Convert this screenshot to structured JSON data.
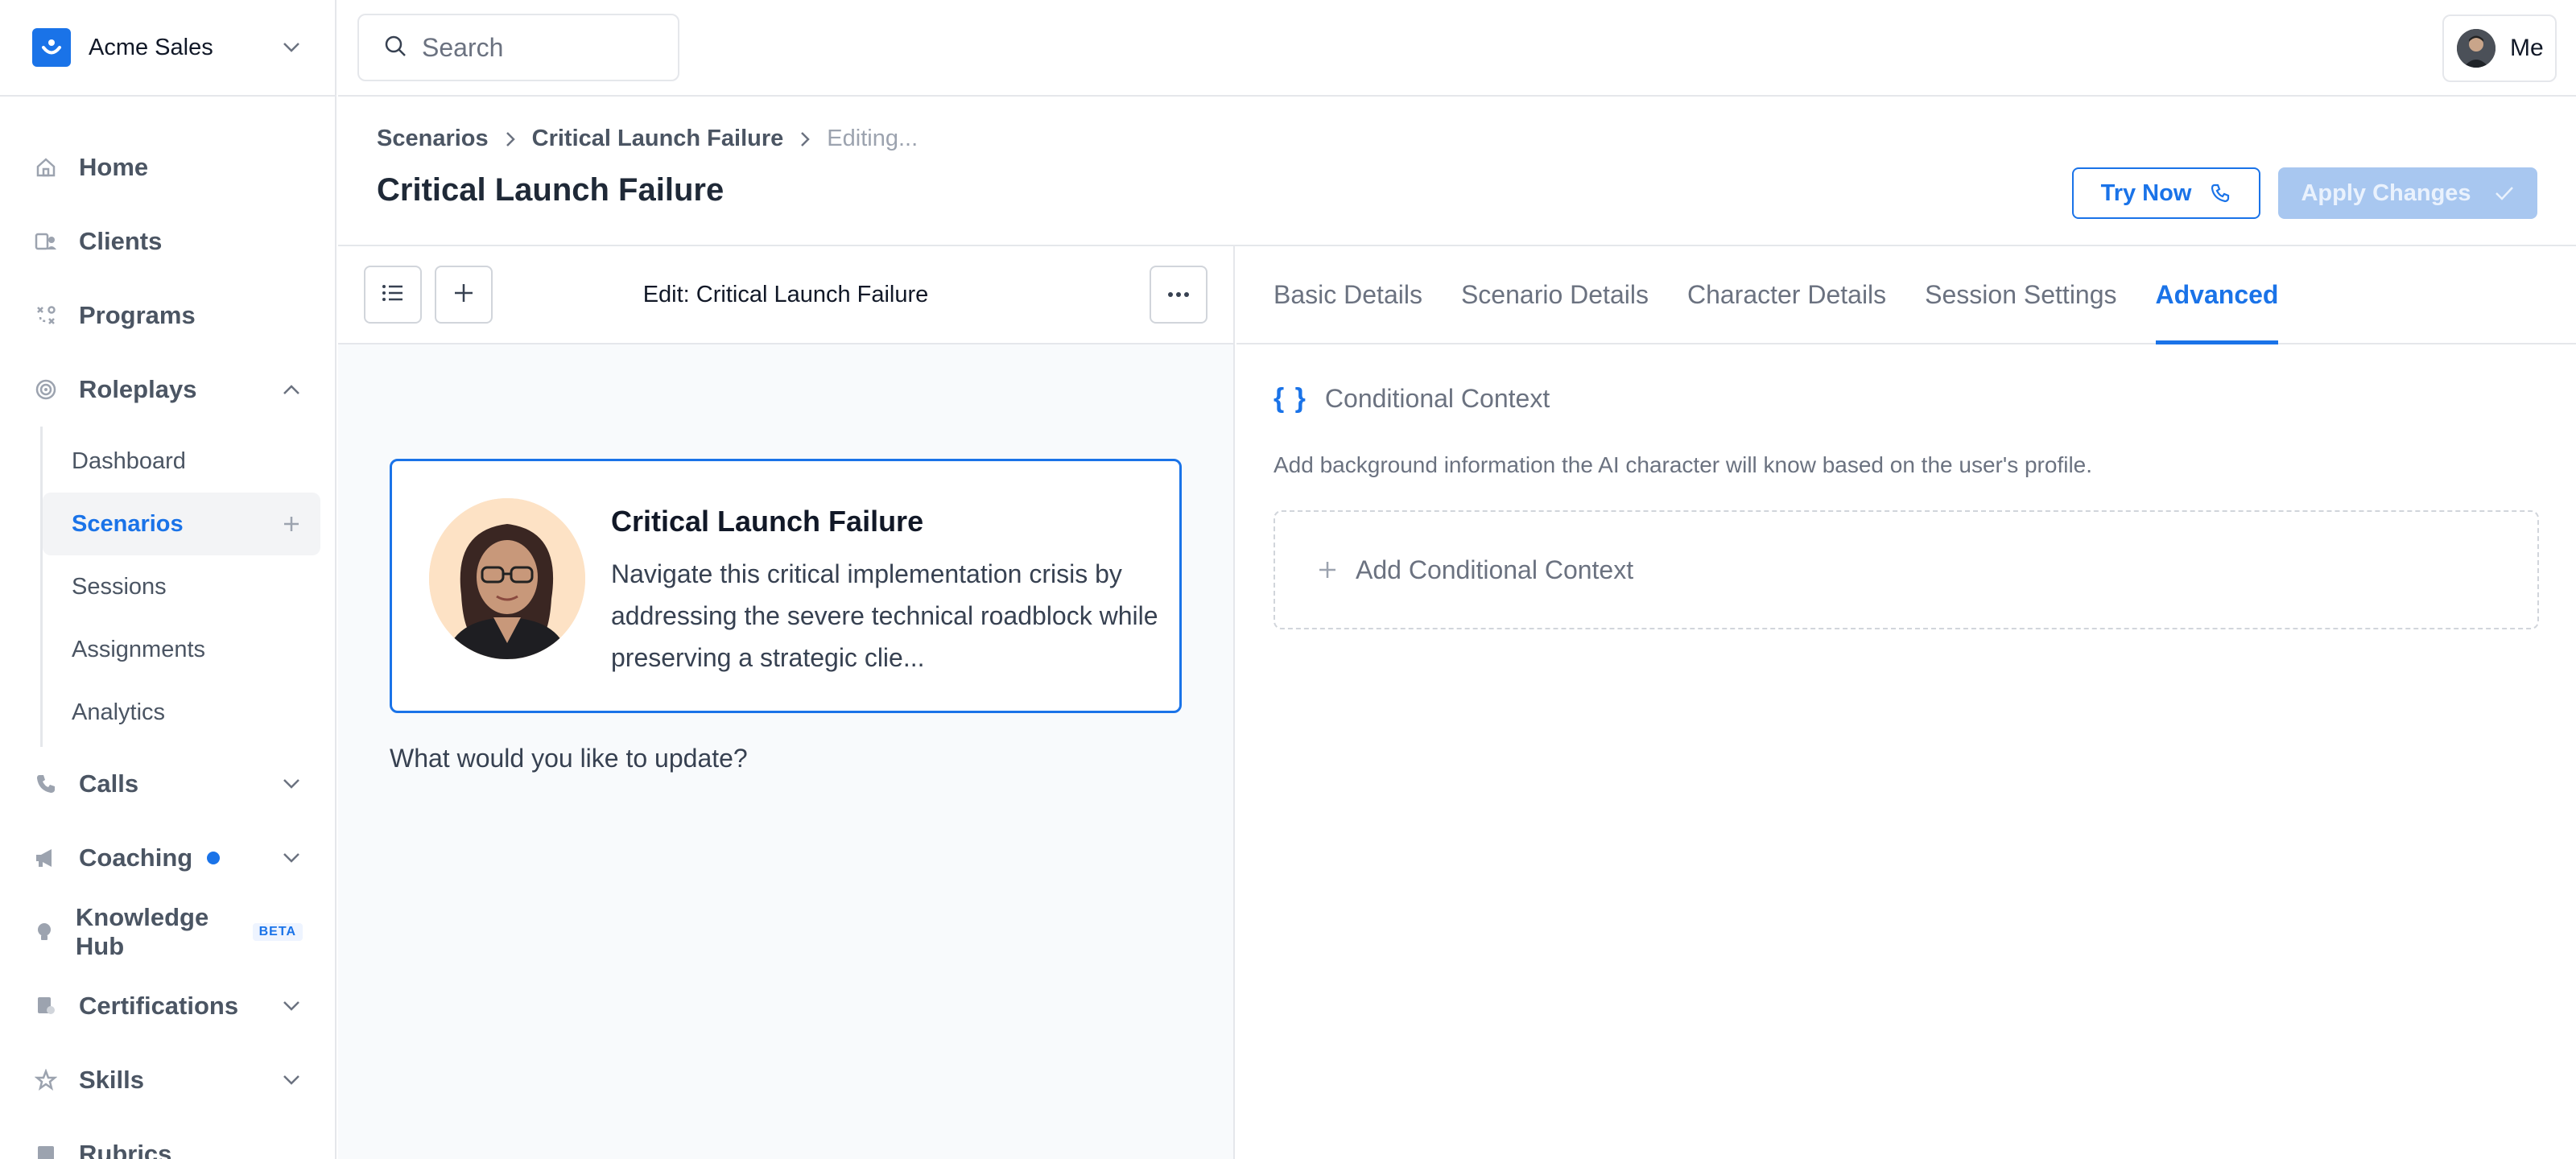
{
  "org": {
    "name": "Acme Sales",
    "logo_icon": "smile-icon"
  },
  "search": {
    "placeholder": "Search"
  },
  "user": {
    "label": "Me"
  },
  "sidebar": {
    "items": [
      {
        "label": "Home",
        "icon": "home-icon"
      },
      {
        "label": "Clients",
        "icon": "clients-icon"
      },
      {
        "label": "Programs",
        "icon": "programs-icon"
      },
      {
        "label": "Roleplays",
        "icon": "target-icon",
        "expanded": true
      },
      {
        "label": "Calls",
        "icon": "phone-icon"
      },
      {
        "label": "Coaching",
        "icon": "megaphone-icon",
        "has_dot": true
      },
      {
        "label": "Knowledge Hub",
        "icon": "lightbulb-icon",
        "badge": "BETA"
      },
      {
        "label": "Certifications",
        "icon": "certificate-icon"
      },
      {
        "label": "Skills",
        "icon": "star-icon"
      },
      {
        "label": "Rubrics",
        "icon": "rubric-icon"
      }
    ],
    "roleplays_sub": [
      {
        "label": "Dashboard"
      },
      {
        "label": "Scenarios",
        "active": true
      },
      {
        "label": "Sessions"
      },
      {
        "label": "Assignments"
      },
      {
        "label": "Analytics"
      }
    ]
  },
  "breadcrumb": [
    "Scenarios",
    "Critical Launch Failure",
    "Editing..."
  ],
  "page": {
    "title": "Critical Launch Failure",
    "try_now": "Try Now",
    "apply_changes": "Apply Changes"
  },
  "editor": {
    "title": "Edit: Critical Launch Failure",
    "card": {
      "title": "Critical Launch Failure",
      "description": "Navigate this critical implementation crisis by addressing the severe technical roadblock while preserving a strategic clie..."
    },
    "prompt": "What would you like to update?"
  },
  "tabs": [
    {
      "label": "Basic Details"
    },
    {
      "label": "Scenario Details"
    },
    {
      "label": "Character Details"
    },
    {
      "label": "Session Settings"
    },
    {
      "label": "Advanced",
      "active": true
    }
  ],
  "advanced": {
    "braces": "{ }",
    "section_title": "Conditional Context",
    "description": "Add background information the AI character will know based on the user's profile.",
    "add_label": "Add Conditional Context"
  },
  "colors": {
    "accent": "#1a73e8",
    "disabled_button": "#a8c7f0",
    "avatar_bg": "#fde2c5"
  }
}
